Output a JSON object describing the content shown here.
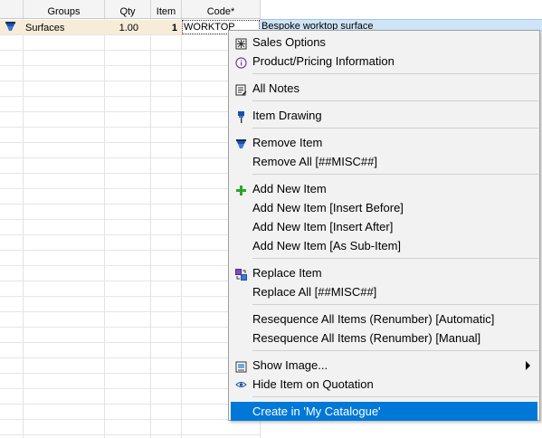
{
  "grid": {
    "headers": {
      "groups": "Groups",
      "qty": "Qty",
      "item": "Item",
      "code": "Code*"
    },
    "row": {
      "group": "Surfaces",
      "qty": "1.00",
      "item": "1",
      "code": "WORKTOP",
      "description": "Bespoke worktop surface"
    }
  },
  "menu": {
    "sales_options": "Sales Options",
    "product_info": "Product/Pricing Information",
    "all_notes": "All Notes",
    "item_drawing": "Item Drawing",
    "remove_item": "Remove Item",
    "remove_all": "Remove All [##MISC##]",
    "add_new_item": "Add New Item",
    "add_insert_before": "Add New Item [Insert Before]",
    "add_insert_after": "Add New Item [Insert After]",
    "add_sub_item": "Add New Item [As Sub-Item]",
    "replace_item": "Replace Item",
    "replace_all": "Replace All [##MISC##]",
    "reseq_auto": "Resequence All Items (Renumber) [Automatic]",
    "reseq_manual": "Resequence All Items (Renumber) [Manual]",
    "show_image": "Show Image...",
    "hide_item": "Hide Item on Quotation",
    "create_catalogue": "Create in 'My Catalogue'"
  },
  "colors": {
    "selection": "#0078d7",
    "row_highlight": "#f7ecd8",
    "description_bg": "#cfe4f7",
    "add_icon": "#2aa52a"
  }
}
